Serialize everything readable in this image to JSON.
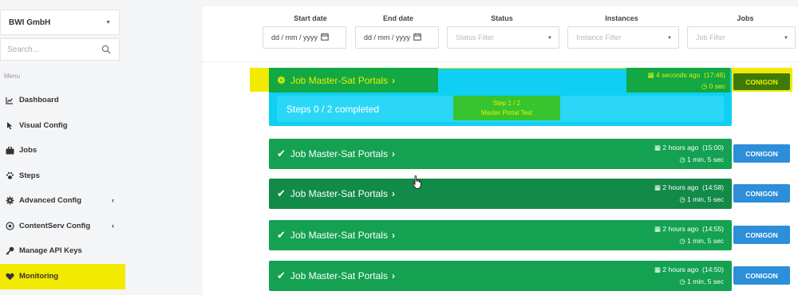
{
  "sidebar": {
    "company": "BWI GmbH",
    "search_placeholder": "Search...",
    "menu_heading": "Menu",
    "items": [
      {
        "label": "Dashboard",
        "icon": "chart-icon"
      },
      {
        "label": "Visual Config",
        "icon": "pointer-icon"
      },
      {
        "label": "Jobs",
        "icon": "briefcase-icon"
      },
      {
        "label": "Steps",
        "icon": "paw-icon"
      },
      {
        "label": "Advanced Config",
        "icon": "gear-icon",
        "arrow": "‹"
      },
      {
        "label": "ContentServ Config",
        "icon": "target-icon",
        "arrow": "‹"
      },
      {
        "label": "Manage API Keys",
        "icon": "key-icon"
      },
      {
        "label": "Monitoring",
        "icon": "heart-icon"
      }
    ]
  },
  "filters": {
    "start_label": "Start date",
    "start_value": "dd / mm / yyyy",
    "end_label": "End date",
    "end_value": "dd / mm / yyyy",
    "status_label": "Status",
    "status_placeholder": "Status Filter",
    "instances_label": "Instances",
    "instances_placeholder": "Instance Filter",
    "jobs_label": "Jobs",
    "jobs_placeholder": "Job Filter"
  },
  "running_job": {
    "title": "Job Master-Sat Portals",
    "ago": "4 seconds ago",
    "time": "(17:46)",
    "duration": "0 sec",
    "instance": "CONIGON",
    "steps_text": "Steps 0 / 2 completed",
    "step_line1": "Step 1 / 2",
    "step_line2": "Master Portal Test"
  },
  "jobs": [
    {
      "title": "Job Master-Sat Portals",
      "ago": "2 hours ago",
      "time": "(15:00)",
      "duration": "1 min, 5 sec",
      "instance": "CONIGON"
    },
    {
      "title": "Job Master-Sat Portals",
      "ago": "2 hours ago",
      "time": "(14:58)",
      "duration": "1 min, 5 sec",
      "instance": "CONIGON"
    },
    {
      "title": "Job Master-Sat Portals",
      "ago": "2 hours ago",
      "time": "(14:55)",
      "duration": "1 min, 5 sec",
      "instance": "CONIGON"
    },
    {
      "title": "Job Master-Sat Portals",
      "ago": "2 hours ago",
      "time": "(14:50)",
      "duration": "1 min, 5 sec",
      "instance": "CONIGON"
    }
  ]
}
